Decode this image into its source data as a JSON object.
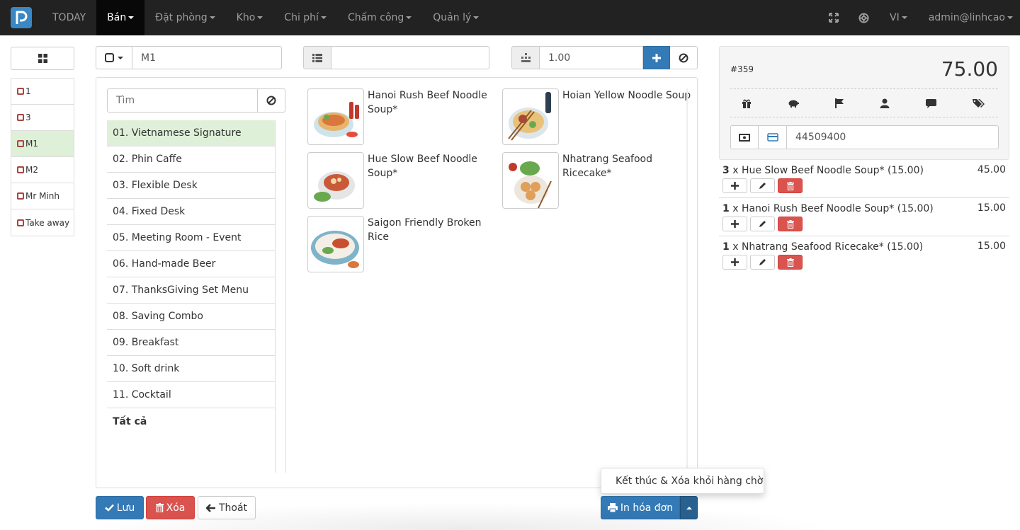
{
  "nav": {
    "items": [
      {
        "label": "TODAY",
        "dropdown": false,
        "active": false
      },
      {
        "label": "Bán",
        "dropdown": true,
        "active": true
      },
      {
        "label": "Đặt phòng",
        "dropdown": true,
        "active": false
      },
      {
        "label": "Kho",
        "dropdown": true,
        "active": false
      },
      {
        "label": "Chi phí",
        "dropdown": true,
        "active": false
      },
      {
        "label": "Chấm công",
        "dropdown": true,
        "active": false
      },
      {
        "label": "Quản lý",
        "dropdown": true,
        "active": false
      }
    ],
    "language": "VI",
    "user": "admin@linhcao"
  },
  "tables": [
    {
      "label": "1",
      "active": false
    },
    {
      "label": "3",
      "active": false
    },
    {
      "label": "M1",
      "active": true
    },
    {
      "label": "M2",
      "active": false
    },
    {
      "label": "Mr Minh",
      "active": false
    },
    {
      "label": "Take away",
      "active": false
    }
  ],
  "top": {
    "table_value": "M1",
    "list_value": "",
    "quantity_value": "1.00"
  },
  "search": {
    "placeholder": "Tìm"
  },
  "categories": [
    {
      "label": "01. Vietnamese Signature",
      "active": true
    },
    {
      "label": "02. Phin Caffe"
    },
    {
      "label": "03. Flexible Desk"
    },
    {
      "label": "04. Fixed Desk"
    },
    {
      "label": "05. Meeting Room - Event"
    },
    {
      "label": "06. Hand-made Beer"
    },
    {
      "label": "07. ThanksGiving Set Menu"
    },
    {
      "label": "08. Saving Combo"
    },
    {
      "label": "09. Breakfast"
    },
    {
      "label": "10. Soft drink"
    },
    {
      "label": "11. Cocktail"
    },
    {
      "label": "Tất cả",
      "bold": true
    }
  ],
  "products": [
    {
      "name": "Hanoi Rush Beef Noodle Soup*"
    },
    {
      "name": "Hoian Yellow Noodle Soup"
    },
    {
      "name": "Hue Slow Beef Noodle Soup*"
    },
    {
      "name": "Nhatrang Seafood Ricecake*"
    },
    {
      "name": "Saigon Friendly Broken Rice"
    }
  ],
  "buttons": {
    "save": "Lưu",
    "delete": "Xóa",
    "exit": "Thoát",
    "print": "In hóa đơn",
    "dropdown_item": "Kết thúc & Xóa khỏi hàng chờ"
  },
  "order": {
    "number": "#359",
    "total": "75.00",
    "payment_value": "44509400",
    "lines": [
      {
        "qty": "3",
        "text": "x Hue Slow Beef Noodle Soup* (15.00)",
        "amount": "45.00"
      },
      {
        "qty": "1",
        "text": "x Hanoi Rush Beef Noodle Soup* (15.00)",
        "amount": "15.00"
      },
      {
        "qty": "1",
        "text": "x Nhatrang Seafood Ricecake* (15.00)",
        "amount": "15.00"
      }
    ]
  },
  "colors": {
    "navbar": "#222222",
    "primary": "#337ab7",
    "danger": "#d9534f",
    "active_row": "#dff0d8"
  }
}
